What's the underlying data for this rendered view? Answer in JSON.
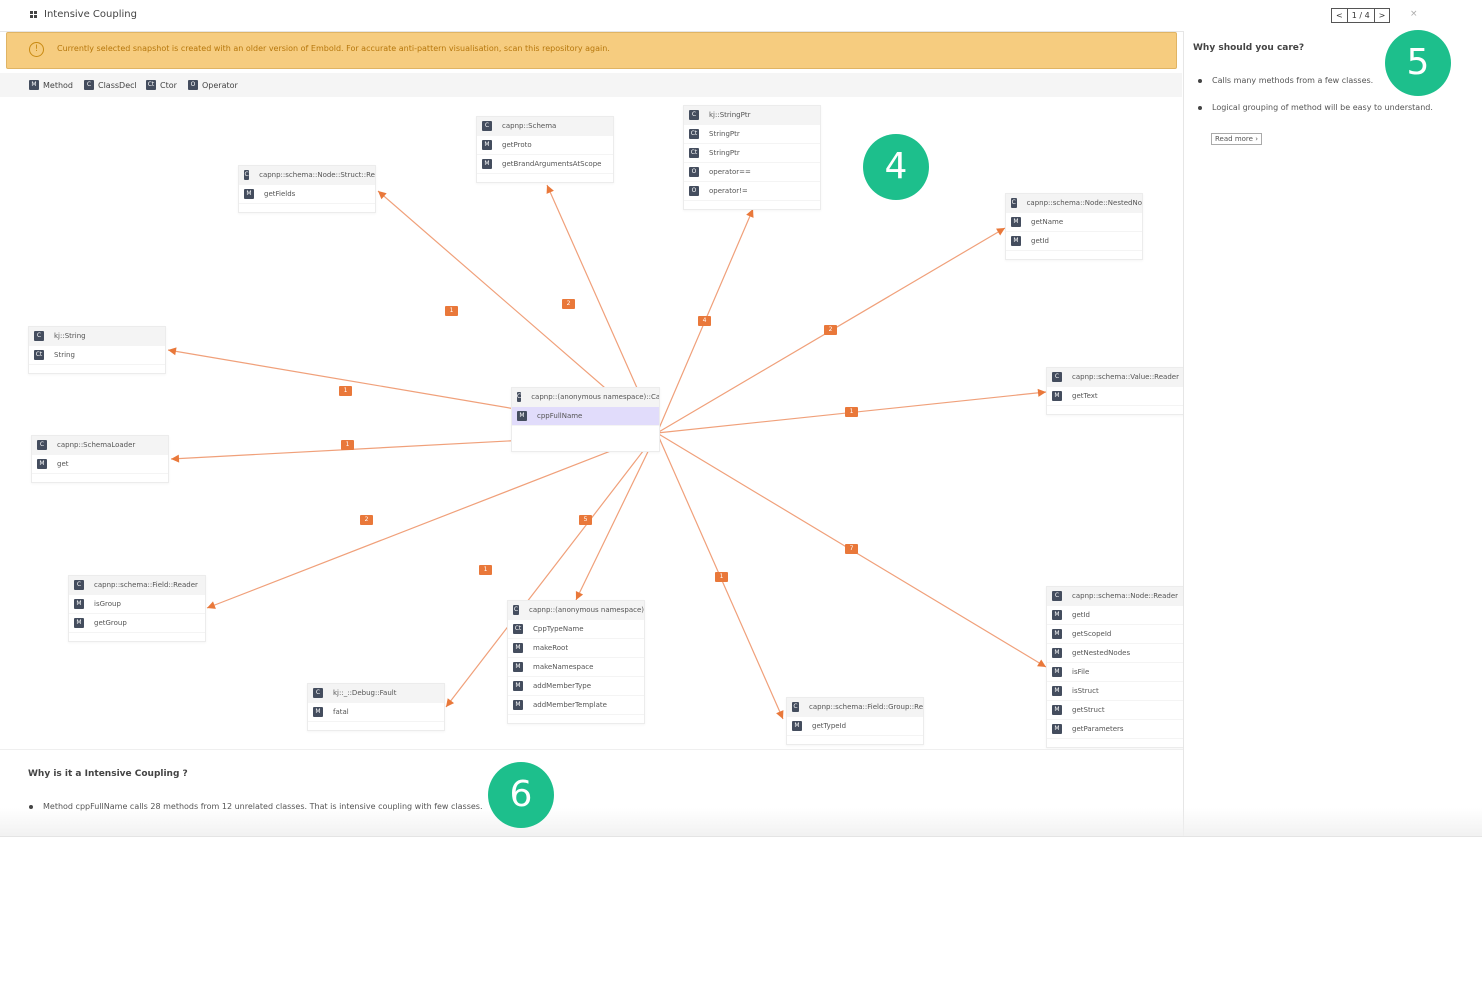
{
  "app": {
    "title": "Intensive Coupling"
  },
  "pager": {
    "prev": "<",
    "page": "1 / 4",
    "next": ">"
  },
  "close": "×",
  "warning": {
    "icon": "!",
    "text": "Currently selected snapshot is created with an older version of Embold. For accurate anti-pattern visualisation, scan this repository again."
  },
  "legend": [
    {
      "badge": "M",
      "label": "Method"
    },
    {
      "badge": "C",
      "label": "ClassDecl"
    },
    {
      "badge": "Ct",
      "label": "Ctor"
    },
    {
      "badge": "O",
      "label": "Operator"
    }
  ],
  "colors": {
    "edge": "#f0a07a",
    "label": "#e9783a",
    "selected": "#e1dcfb",
    "warning": "#f6cc7f",
    "marker": "#1dbf8c"
  },
  "center": {
    "class": "capnp::(anonymous namespace)::Capnp",
    "method": "cppFullName"
  },
  "nodes": [
    {
      "id": "n_struct",
      "rows": [
        {
          "badge": "C",
          "label": "capnp::schema::Node::Struct::Re"
        },
        {
          "badge": "M",
          "label": "getFields"
        }
      ],
      "count": "1"
    },
    {
      "id": "n_schema",
      "rows": [
        {
          "badge": "C",
          "label": "capnp::Schema"
        },
        {
          "badge": "M",
          "label": "getProto"
        },
        {
          "badge": "M",
          "label": "getBrandArgumentsAtScope"
        }
      ],
      "count": "2"
    },
    {
      "id": "n_stringptr",
      "rows": [
        {
          "badge": "C",
          "label": "kj::StringPtr"
        },
        {
          "badge": "Ct",
          "label": "StringPtr"
        },
        {
          "badge": "Ct",
          "label": "StringPtr"
        },
        {
          "badge": "O",
          "label": "operator=="
        },
        {
          "badge": "O",
          "label": "operator!="
        }
      ],
      "count": "4"
    },
    {
      "id": "n_nested",
      "rows": [
        {
          "badge": "C",
          "label": "capnp::schema::Node::NestedNo"
        },
        {
          "badge": "M",
          "label": "getName"
        },
        {
          "badge": "M",
          "label": "getId"
        }
      ],
      "count": "2"
    },
    {
      "id": "n_kjstring",
      "rows": [
        {
          "badge": "C",
          "label": "kj::String"
        },
        {
          "badge": "Ct",
          "label": "String"
        }
      ],
      "count": "1"
    },
    {
      "id": "n_value",
      "rows": [
        {
          "badge": "C",
          "label": "capnp::schema::Value::Reader"
        },
        {
          "badge": "M",
          "label": "getText"
        }
      ],
      "count": "1"
    },
    {
      "id": "n_loader",
      "rows": [
        {
          "badge": "C",
          "label": "capnp::SchemaLoader"
        },
        {
          "badge": "M",
          "label": "get"
        }
      ],
      "count": "1"
    },
    {
      "id": "n_field",
      "rows": [
        {
          "badge": "C",
          "label": "capnp::schema::Field::Reader"
        },
        {
          "badge": "M",
          "label": "isGroup"
        },
        {
          "badge": "M",
          "label": "getGroup"
        }
      ],
      "count": "2"
    },
    {
      "id": "n_anon",
      "rows": [
        {
          "badge": "C",
          "label": "capnp::(anonymous namespace)"
        },
        {
          "badge": "Ct",
          "label": "CppTypeName"
        },
        {
          "badge": "M",
          "label": "makeRoot"
        },
        {
          "badge": "M",
          "label": "makeNamespace"
        },
        {
          "badge": "M",
          "label": "addMemberType"
        },
        {
          "badge": "M",
          "label": "addMemberTemplate"
        }
      ],
      "count": "5"
    },
    {
      "id": "n_fault",
      "rows": [
        {
          "badge": "C",
          "label": "kj::_::Debug::Fault"
        },
        {
          "badge": "M",
          "label": "fatal"
        }
      ],
      "count": "1"
    },
    {
      "id": "n_group",
      "rows": [
        {
          "badge": "C",
          "label": "capnp::schema::Field::Group::Re"
        },
        {
          "badge": "M",
          "label": "getTypeId"
        }
      ],
      "count": "1"
    },
    {
      "id": "n_node",
      "rows": [
        {
          "badge": "C",
          "label": "capnp::schema::Node::Reader"
        },
        {
          "badge": "M",
          "label": "getId"
        },
        {
          "badge": "M",
          "label": "getScopeId"
        },
        {
          "badge": "M",
          "label": "getNestedNodes"
        },
        {
          "badge": "M",
          "label": "isFile"
        },
        {
          "badge": "M",
          "label": "isStruct"
        },
        {
          "badge": "M",
          "label": "getStruct"
        },
        {
          "badge": "M",
          "label": "getParameters"
        }
      ],
      "count": "7"
    }
  ],
  "side": {
    "title": "Why should you care?",
    "bullets": [
      "Calls many methods from a few classes.",
      "Logical grouping of method will be easy to understand."
    ],
    "read_more": "Read more"
  },
  "bottom": {
    "title": "Why is it a Intensive Coupling ?",
    "text": "Method cppFullName calls 28 methods from 12 unrelated classes. That is intensive coupling with few classes."
  },
  "markers": [
    "4",
    "5",
    "6"
  ]
}
